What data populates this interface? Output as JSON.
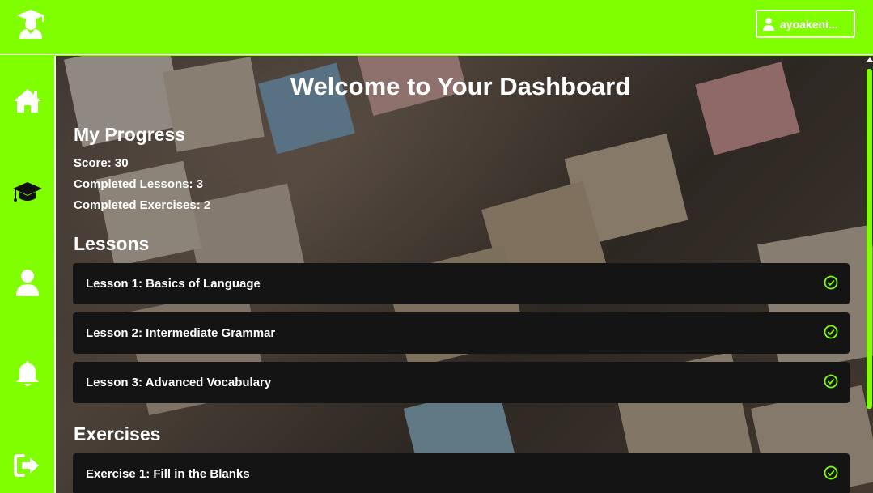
{
  "header": {
    "logo_icon": "graduate-icon",
    "username": "ayoakeni...",
    "user_icon": "user-icon",
    "brand_color": "#80ff00"
  },
  "sidebar": {
    "items": [
      {
        "icon": "home-icon"
      },
      {
        "icon": "graduation-cap-icon"
      },
      {
        "icon": "user-icon"
      },
      {
        "icon": "bell-icon"
      },
      {
        "icon": "logout-icon"
      }
    ]
  },
  "main": {
    "title": "Welcome to Your Dashboard",
    "progress": {
      "heading": "My Progress",
      "score": "Score: 30",
      "completed_lessons": "Completed Lessons: 3",
      "completed_exercises": "Completed Exercises: 2"
    },
    "lessons": {
      "heading": "Lessons",
      "items": [
        {
          "label": "Lesson 1: Basics of Language",
          "status_icon": "check-circle-icon"
        },
        {
          "label": "Lesson 2: Intermediate Grammar",
          "status_icon": "check-circle-icon"
        },
        {
          "label": "Lesson 3: Advanced Vocabulary",
          "status_icon": "check-circle-icon"
        }
      ]
    },
    "exercises": {
      "heading": "Exercises",
      "items": [
        {
          "label": "Exercise 1: Fill in the Blanks",
          "status_icon": "check-circle-icon"
        }
      ]
    },
    "check_color": "#7fff00"
  }
}
